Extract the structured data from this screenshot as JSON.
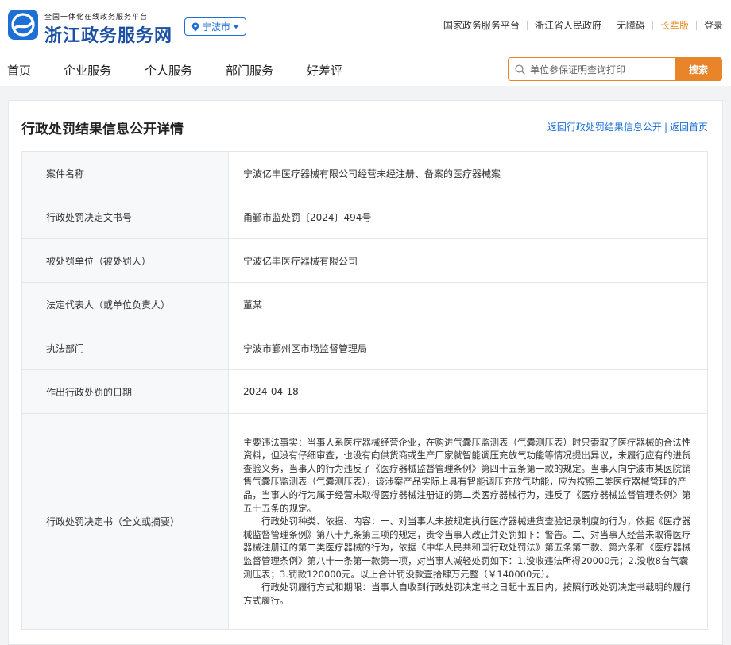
{
  "header": {
    "subtitle": "全国一体化在线政务服务平台",
    "title": "浙江政务服务网",
    "city": "宁波市",
    "links": [
      "国家政务服务平台",
      "浙江省人民政府",
      "无障碍",
      "长辈版",
      "登录"
    ]
  },
  "nav": [
    "首页",
    "企业服务",
    "个人服务",
    "部门服务",
    "好差评"
  ],
  "search": {
    "value": "单位参保证明查询打印",
    "button": "搜索"
  },
  "page": {
    "title": "行政处罚结果信息公开详情",
    "back_list": "返回行政处罚结果信息公开",
    "sep": "|",
    "back_home": "返回首页"
  },
  "rows": [
    {
      "key": "案件名称",
      "value": "宁波亿丰医疗器械有限公司经营未经注册、备案的医疗器械案"
    },
    {
      "key": "行政处罚决定文书号",
      "value": "甬鄞市监处罚〔2024〕494号"
    },
    {
      "key": "被处罚单位（被处罚人）",
      "value": "宁波亿丰医疗器械有限公司"
    },
    {
      "key": "法定代表人（或单位负责人）",
      "value": "董某"
    },
    {
      "key": "执法部门",
      "value": "宁波市鄞州区市场监督管理局"
    },
    {
      "key": "作出行政处罚的日期",
      "value": "2024-04-18"
    }
  ],
  "decision": {
    "key": "行政处罚决定书（全文或摘要）",
    "p1": "主要违法事实：当事人系医疗器械经营企业，在购进气囊压监测表（气囊测压表）时只索取了医疗器械的合法性资料，但没有仔细审查，也没有向供货商或生产厂家就智能调压充放气功能等情况提出异议，未履行应有的进货查验义务，当事人的行为违反了《医疗器械监督管理条例》第四十五条第一款的规定。当事人向宁波市某医院销售气囊压监测表（气囊测压表），该涉案产品实际上具有智能调压充放气功能，应为按照二类医疗器械管理的产品，当事人的行为属于经营未取得医疗器械注册证的第二类医疗器械行为，违反了《医疗器械监督管理条例》第五十五条的规定。",
    "p2": "行政处罚种类、依据、内容：一、对当事人未按规定执行医疗器械进货查验记录制度的行为，依据《医疗器械监督管理条例》第八十九条第三项的规定，责令当事人改正并处罚如下：警告。二、对当事人经营未取得医疗器械注册证的第二类医疗器械的行为，依据《中华人民共和国行政处罚法》第五条第二款、第六条和《医疗器械监督管理条例》第八十一条第一款第一项，对当事人减轻处罚如下：1.没收违法所得20000元；2.没收8台气囊测压表；3.罚款120000元。以上合计罚没款壹拾肆万元整（￥140000元）。",
    "p3": "行政处罚履行方式和期限：当事人自收到行政处罚决定书之日起十五日内，按照行政处罚决定书载明的履行方式履行。"
  },
  "colors": {
    "brand_blue": "#1d6fd6",
    "search_orange": "#e8852b",
    "elder_orange": "#e88a1a"
  },
  "icons": [
    "logo-icon",
    "location-pin-icon",
    "caret-down-icon",
    "search-icon"
  ]
}
